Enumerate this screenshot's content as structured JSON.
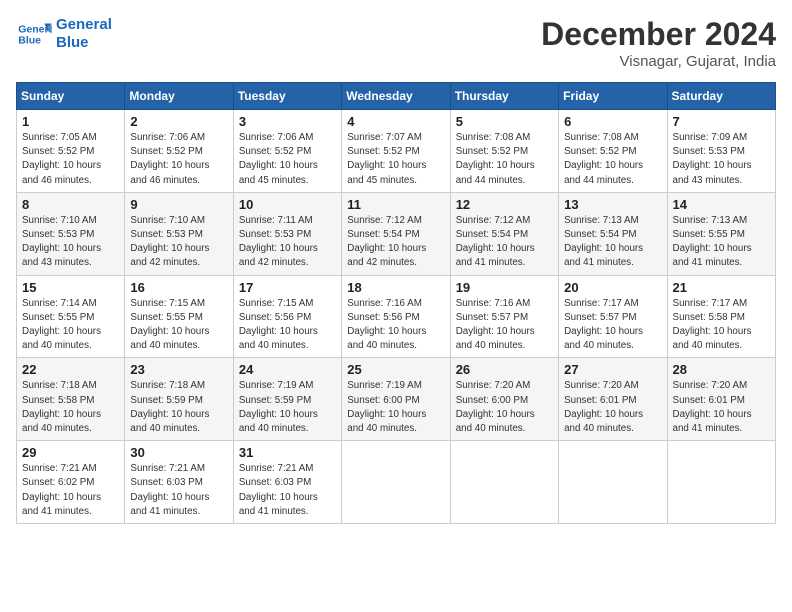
{
  "header": {
    "logo_line1": "General",
    "logo_line2": "Blue",
    "month": "December 2024",
    "location": "Visnagar, Gujarat, India"
  },
  "weekdays": [
    "Sunday",
    "Monday",
    "Tuesday",
    "Wednesday",
    "Thursday",
    "Friday",
    "Saturday"
  ],
  "weeks": [
    [
      {
        "day": "1",
        "info": "Sunrise: 7:05 AM\nSunset: 5:52 PM\nDaylight: 10 hours\nand 46 minutes."
      },
      {
        "day": "2",
        "info": "Sunrise: 7:06 AM\nSunset: 5:52 PM\nDaylight: 10 hours\nand 46 minutes."
      },
      {
        "day": "3",
        "info": "Sunrise: 7:06 AM\nSunset: 5:52 PM\nDaylight: 10 hours\nand 45 minutes."
      },
      {
        "day": "4",
        "info": "Sunrise: 7:07 AM\nSunset: 5:52 PM\nDaylight: 10 hours\nand 45 minutes."
      },
      {
        "day": "5",
        "info": "Sunrise: 7:08 AM\nSunset: 5:52 PM\nDaylight: 10 hours\nand 44 minutes."
      },
      {
        "day": "6",
        "info": "Sunrise: 7:08 AM\nSunset: 5:52 PM\nDaylight: 10 hours\nand 44 minutes."
      },
      {
        "day": "7",
        "info": "Sunrise: 7:09 AM\nSunset: 5:53 PM\nDaylight: 10 hours\nand 43 minutes."
      }
    ],
    [
      {
        "day": "8",
        "info": "Sunrise: 7:10 AM\nSunset: 5:53 PM\nDaylight: 10 hours\nand 43 minutes."
      },
      {
        "day": "9",
        "info": "Sunrise: 7:10 AM\nSunset: 5:53 PM\nDaylight: 10 hours\nand 42 minutes."
      },
      {
        "day": "10",
        "info": "Sunrise: 7:11 AM\nSunset: 5:53 PM\nDaylight: 10 hours\nand 42 minutes."
      },
      {
        "day": "11",
        "info": "Sunrise: 7:12 AM\nSunset: 5:54 PM\nDaylight: 10 hours\nand 42 minutes."
      },
      {
        "day": "12",
        "info": "Sunrise: 7:12 AM\nSunset: 5:54 PM\nDaylight: 10 hours\nand 41 minutes."
      },
      {
        "day": "13",
        "info": "Sunrise: 7:13 AM\nSunset: 5:54 PM\nDaylight: 10 hours\nand 41 minutes."
      },
      {
        "day": "14",
        "info": "Sunrise: 7:13 AM\nSunset: 5:55 PM\nDaylight: 10 hours\nand 41 minutes."
      }
    ],
    [
      {
        "day": "15",
        "info": "Sunrise: 7:14 AM\nSunset: 5:55 PM\nDaylight: 10 hours\nand 40 minutes."
      },
      {
        "day": "16",
        "info": "Sunrise: 7:15 AM\nSunset: 5:55 PM\nDaylight: 10 hours\nand 40 minutes."
      },
      {
        "day": "17",
        "info": "Sunrise: 7:15 AM\nSunset: 5:56 PM\nDaylight: 10 hours\nand 40 minutes."
      },
      {
        "day": "18",
        "info": "Sunrise: 7:16 AM\nSunset: 5:56 PM\nDaylight: 10 hours\nand 40 minutes."
      },
      {
        "day": "19",
        "info": "Sunrise: 7:16 AM\nSunset: 5:57 PM\nDaylight: 10 hours\nand 40 minutes."
      },
      {
        "day": "20",
        "info": "Sunrise: 7:17 AM\nSunset: 5:57 PM\nDaylight: 10 hours\nand 40 minutes."
      },
      {
        "day": "21",
        "info": "Sunrise: 7:17 AM\nSunset: 5:58 PM\nDaylight: 10 hours\nand 40 minutes."
      }
    ],
    [
      {
        "day": "22",
        "info": "Sunrise: 7:18 AM\nSunset: 5:58 PM\nDaylight: 10 hours\nand 40 minutes."
      },
      {
        "day": "23",
        "info": "Sunrise: 7:18 AM\nSunset: 5:59 PM\nDaylight: 10 hours\nand 40 minutes."
      },
      {
        "day": "24",
        "info": "Sunrise: 7:19 AM\nSunset: 5:59 PM\nDaylight: 10 hours\nand 40 minutes."
      },
      {
        "day": "25",
        "info": "Sunrise: 7:19 AM\nSunset: 6:00 PM\nDaylight: 10 hours\nand 40 minutes."
      },
      {
        "day": "26",
        "info": "Sunrise: 7:20 AM\nSunset: 6:00 PM\nDaylight: 10 hours\nand 40 minutes."
      },
      {
        "day": "27",
        "info": "Sunrise: 7:20 AM\nSunset: 6:01 PM\nDaylight: 10 hours\nand 40 minutes."
      },
      {
        "day": "28",
        "info": "Sunrise: 7:20 AM\nSunset: 6:01 PM\nDaylight: 10 hours\nand 41 minutes."
      }
    ],
    [
      {
        "day": "29",
        "info": "Sunrise: 7:21 AM\nSunset: 6:02 PM\nDaylight: 10 hours\nand 41 minutes."
      },
      {
        "day": "30",
        "info": "Sunrise: 7:21 AM\nSunset: 6:03 PM\nDaylight: 10 hours\nand 41 minutes."
      },
      {
        "day": "31",
        "info": "Sunrise: 7:21 AM\nSunset: 6:03 PM\nDaylight: 10 hours\nand 41 minutes."
      },
      null,
      null,
      null,
      null
    ]
  ]
}
